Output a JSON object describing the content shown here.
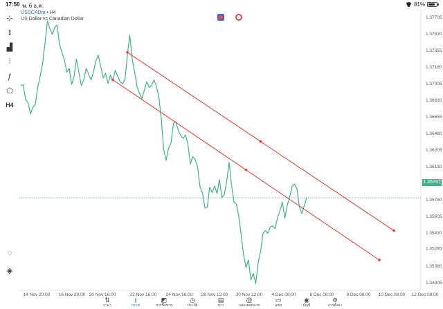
{
  "status_bar": {
    "time": "17:56",
    "date": "พ. 6 ธ.ค.",
    "battery": "81%",
    "battery_level": 0.81
  },
  "chart": {
    "symbol": "USDCADm",
    "separator": "•",
    "timeframe": "H4",
    "description": "US Dollar vs Canadian Dollar",
    "last_price": "1.35797",
    "colors": {
      "price_line": "#3cb38a",
      "channel": "#e53935",
      "badge": "#3cb38a"
    }
  },
  "toolbar": {
    "items": [
      {
        "icon": "crosshair-icon",
        "glyph": "⊹"
      },
      {
        "icon": "candlestick-icon",
        "glyph": "⫾"
      },
      {
        "icon": "indicators-icon",
        "glyph": "▟"
      },
      {
        "icon": "adjust-icon",
        "glyph": "⫶"
      },
      {
        "icon": "function-icon",
        "glyph": "ƒ"
      },
      {
        "icon": "objects-icon",
        "glyph": "⬠"
      },
      {
        "icon": "timeframe-label",
        "glyph": "H4"
      }
    ],
    "bottom": [
      {
        "icon": "chat-icon",
        "glyph": "◌"
      },
      {
        "icon": "broker-icon",
        "glyph": "◈"
      }
    ]
  },
  "chart_data": {
    "type": "line",
    "symbol": "USDCADm",
    "timeframe": "H4",
    "y_ticks": [
      "1.37705",
      "1.37530",
      "1.37355",
      "1.37180",
      "1.37005",
      "1.36830",
      "1.36655",
      "1.36480",
      "1.36305",
      "1.36130",
      "1.35955",
      "1.35780",
      "1.35605",
      "1.35430",
      "1.35265",
      "1.35080",
      "1.34905"
    ],
    "x_ticks": [
      "14 Nov 20:00",
      "16 Nov 20:00",
      "20 Nov 16:00",
      "22 Nov 16:00",
      "24 Nov 16:00",
      "28 Nov 12:00",
      "30 Nov 12:00",
      "4 Dec 08:00",
      "6 Dec 08:00",
      "8 Dec 08:00",
      "10 Dec 08:00",
      "12 Dec 08:00"
    ],
    "ylim": [
      1.3482,
      1.3778
    ],
    "series": [
      {
        "values": [
          1.3698,
          1.3699,
          1.3683,
          1.368,
          1.3668,
          1.3675,
          1.3678,
          1.3696,
          1.3708,
          1.3721,
          1.3742,
          1.3766,
          1.3758,
          1.3752,
          1.3759,
          1.3762,
          1.3741,
          1.3733,
          1.3725,
          1.3712,
          1.3716,
          1.3699,
          1.3708,
          1.3726,
          1.3712,
          1.3698,
          1.3704,
          1.3716,
          1.371,
          1.3704,
          1.3712,
          1.3724,
          1.373,
          1.3718,
          1.3706,
          1.3711,
          1.37,
          1.3709,
          1.3703,
          1.3714,
          1.3708,
          1.3702,
          1.37,
          1.3704,
          1.373,
          1.3751,
          1.3726,
          1.3712,
          1.3697,
          1.369,
          1.3684,
          1.3693,
          1.3702,
          1.3696,
          1.3698,
          1.3704,
          1.3697,
          1.3686,
          1.3663,
          1.363,
          1.3619,
          1.3632,
          1.3637,
          1.3658,
          1.366,
          1.3651,
          1.3645,
          1.3642,
          1.3646,
          1.3636,
          1.3615,
          1.3623,
          1.362,
          1.3612,
          1.3591,
          1.3585,
          1.3569,
          1.357,
          1.3591,
          1.3585,
          1.3592,
          1.3584,
          1.3599,
          1.358,
          1.3583,
          1.3597,
          1.3617,
          1.3593,
          1.3575,
          1.3573,
          1.356,
          1.354,
          1.3519,
          1.3506,
          1.3514,
          1.3493,
          1.35,
          1.3489,
          1.3511,
          1.3523,
          1.3542,
          1.3545,
          1.3542,
          1.3549,
          1.355,
          1.3547,
          1.3559,
          1.3566,
          1.3575,
          1.3558,
          1.3572,
          1.358,
          1.3592,
          1.3594,
          1.3589,
          1.357,
          1.3563,
          1.3571,
          1.358
        ]
      }
    ],
    "annotations": [
      {
        "type": "trend_channel_upper",
        "from": {
          "x_index": 44,
          "y": 1.3733
        },
        "to": {
          "x_index": 154,
          "y": 1.3545
        }
      },
      {
        "type": "trend_channel_lower",
        "from": {
          "x_index": 38,
          "y": 1.3704
        },
        "to": {
          "x_index": 148,
          "y": 1.3514
        }
      }
    ],
    "last_price_line": 1.35797,
    "grid": false
  },
  "tabs": [
    {
      "icon": "quotes-icon",
      "glyph": "⇅",
      "label": "ราคา",
      "active": false
    },
    {
      "icon": "chart-icon",
      "glyph": "⫾",
      "label": "กราฟ",
      "active": true
    },
    {
      "icon": "trade-icon",
      "glyph": "◩",
      "label": "การซื้อขาย",
      "active": false
    },
    {
      "icon": "history-icon",
      "glyph": "◷",
      "label": "ประวัติ",
      "active": false
    },
    {
      "icon": "news-icon",
      "glyph": "▤",
      "label": "ข่าว",
      "active": false
    },
    {
      "icon": "mailbox-icon",
      "glyph": "@",
      "label": "กล่องจดหมาย",
      "active": false
    },
    {
      "icon": "chat-tab-icon",
      "glyph": "▭",
      "label": "แชท",
      "active": false
    },
    {
      "icon": "account-icon",
      "glyph": "◉",
      "label": "บัญชี",
      "active": false
    },
    {
      "icon": "settings-icon",
      "glyph": "⚙",
      "label": "การตั้งค่า",
      "active": false
    }
  ]
}
